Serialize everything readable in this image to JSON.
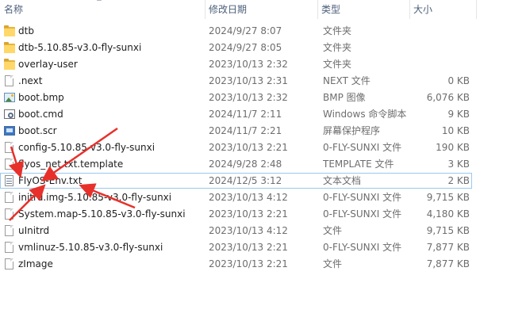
{
  "columns": {
    "name": "名称",
    "date": "修改日期",
    "type": "类型",
    "size": "大小"
  },
  "files": [
    {
      "name": "dtb",
      "date": "2024/9/27 8:07",
      "type": "文件夹",
      "size": "",
      "icon": "folder-icon"
    },
    {
      "name": "dtb-5.10.85-v3.0-fly-sunxi",
      "date": "2024/9/27 8:05",
      "type": "文件夹",
      "size": "",
      "icon": "folder-icon"
    },
    {
      "name": "overlay-user",
      "date": "2023/10/13 2:32",
      "type": "文件夹",
      "size": "",
      "icon": "folder-icon"
    },
    {
      "name": ".next",
      "date": "2023/10/13 2:31",
      "type": "NEXT 文件",
      "size": "0 KB",
      "icon": "file-icon"
    },
    {
      "name": "boot.bmp",
      "date": "2023/10/13 2:32",
      "type": "BMP 图像",
      "size": "6,076 KB",
      "icon": "image-icon"
    },
    {
      "name": "boot.cmd",
      "date": "2024/11/7 2:11",
      "type": "Windows 命令脚本",
      "size": "9 KB",
      "icon": "cmd-script-icon"
    },
    {
      "name": "boot.scr",
      "date": "2024/11/7 2:21",
      "type": "屏幕保护程序",
      "size": "10 KB",
      "icon": "screensaver-icon"
    },
    {
      "name": "config-5.10.85-v3.0-fly-sunxi",
      "date": "2023/10/13 2:21",
      "type": "0-FLY-SUNXI 文件",
      "size": "190 KB",
      "icon": "file-icon"
    },
    {
      "name": "flyos_net.txt.template",
      "date": "2024/9/28 2:48",
      "type": "TEMPLATE 文件",
      "size": "3 KB",
      "icon": "file-icon"
    },
    {
      "name": "FlyOS-Env.txt",
      "date": "2024/12/5 3:12",
      "type": "文本文档",
      "size": "2 KB",
      "icon": "text-file-icon",
      "selected": true
    },
    {
      "name": "initrd.img-5.10.85-v3.0-fly-sunxi",
      "date": "2023/10/13 4:12",
      "type": "0-FLY-SUNXI 文件",
      "size": "9,715 KB",
      "icon": "file-icon"
    },
    {
      "name": "System.map-5.10.85-v3.0-fly-sunxi",
      "date": "2023/10/13 2:21",
      "type": "0-FLY-SUNXI 文件",
      "size": "4,180 KB",
      "icon": "file-icon"
    },
    {
      "name": "uInitrd",
      "date": "2023/10/13 4:12",
      "type": "文件",
      "size": "9,715 KB",
      "icon": "file-icon"
    },
    {
      "name": "vmlinuz-5.10.85-v3.0-fly-sunxi",
      "date": "2023/10/13 2:21",
      "type": "0-FLY-SUNXI 文件",
      "size": "7,877 KB",
      "icon": "file-icon"
    },
    {
      "name": "zImage",
      "date": "2023/10/13 2:21",
      "type": "文件",
      "size": "7,877 KB",
      "icon": "file-icon"
    }
  ],
  "annotation_color": "#e8302a"
}
